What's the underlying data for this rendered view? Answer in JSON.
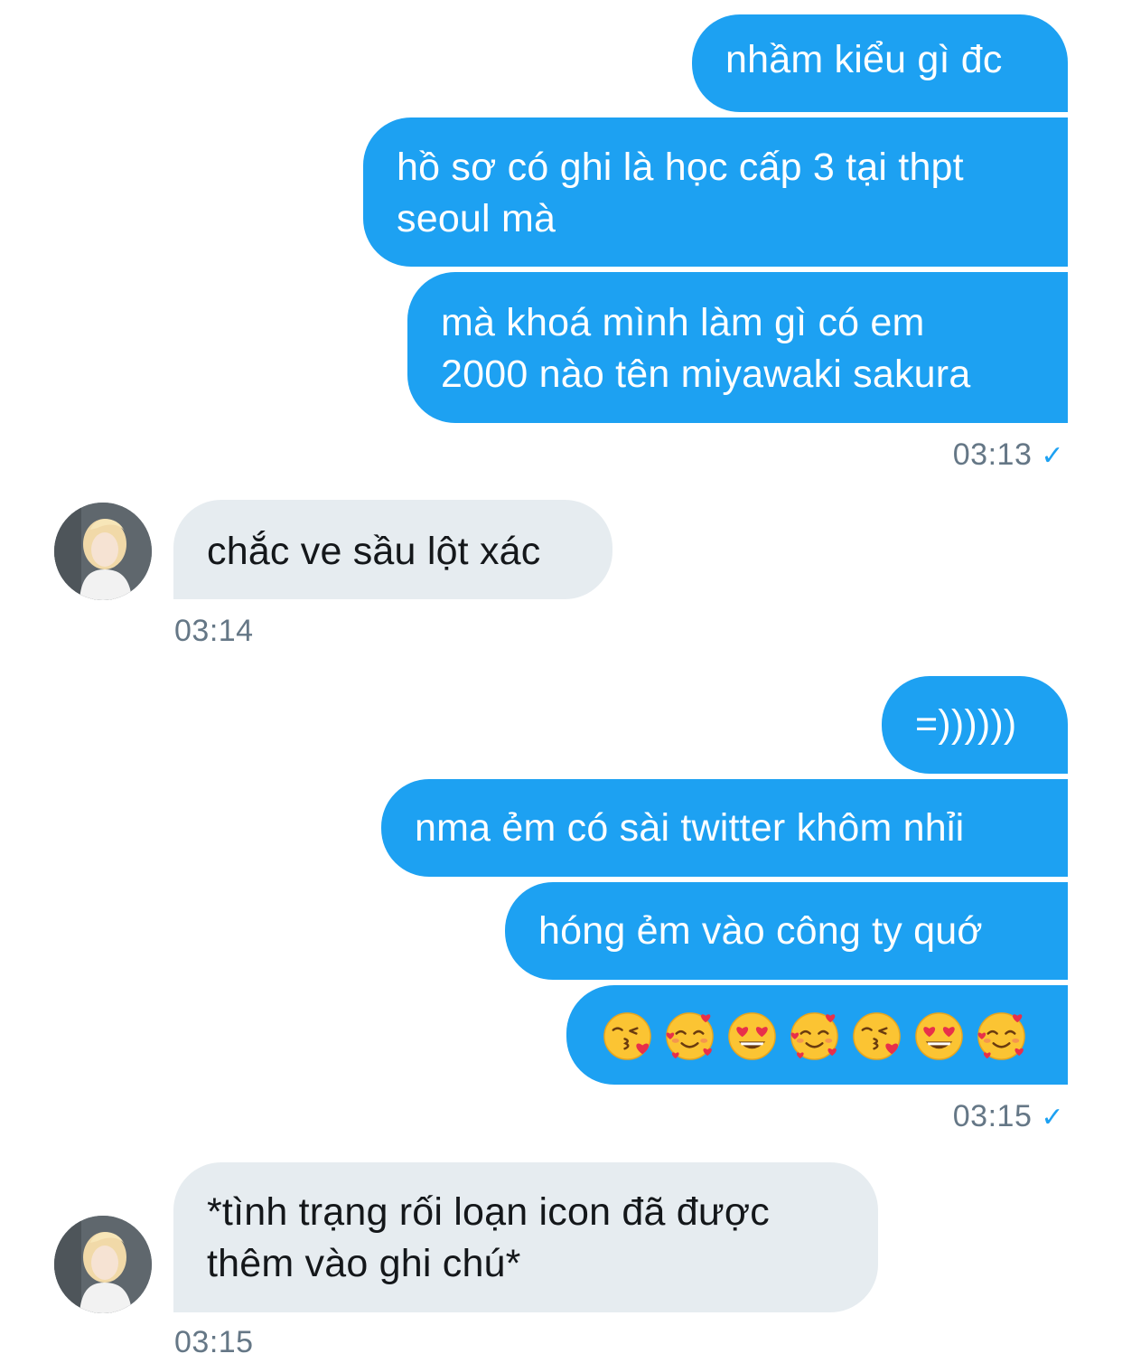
{
  "messages": [
    {
      "dir": "out",
      "text": "nhầm kiểu gì đc"
    },
    {
      "dir": "out",
      "lines": [
        "hồ sơ có ghi là học cấp 3 tại thpt",
        "seoul mà"
      ]
    },
    {
      "dir": "out",
      "lines": [
        "mà khoá mình làm gì có em",
        "2000 nào tên miyawaki sakura"
      ]
    },
    {
      "dir": "in",
      "text": "chắc ve sầu lột xác"
    },
    {
      "dir": "out",
      "text": "=))))))"
    },
    {
      "dir": "out",
      "text": "nma ẻm có sài twitter khôm nhỉi"
    },
    {
      "dir": "out",
      "text": "hóng ẻm vào công ty quớ"
    },
    {
      "dir": "out",
      "emojis": [
        "kissing-heart",
        "smiling-hearts",
        "heart-eyes",
        "smiling-hearts",
        "kissing-heart",
        "heart-eyes",
        "smiling-hearts"
      ]
    },
    {
      "dir": "in",
      "lines": [
        "*tình trạng rối loạn icon đã được",
        "thêm vào ghi chú*"
      ]
    }
  ],
  "timestamps": {
    "t1": "03:13",
    "t2": "03:14",
    "t3": "03:15",
    "t4": "03:15"
  },
  "read_mark": "✓",
  "colors": {
    "outgoing_bubble": "#1da1f2",
    "incoming_bubble": "#e6ecf0",
    "timestamp": "#657786"
  }
}
